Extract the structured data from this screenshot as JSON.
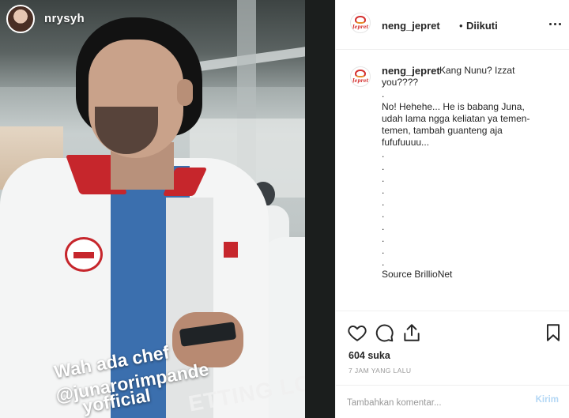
{
  "story": {
    "username": "nrysyh",
    "sticker_lines": [
      "Wah ada chef",
      "@junarorimpande",
      "yofficial"
    ],
    "bottom_caption": "ETTING LONG"
  },
  "post": {
    "header": {
      "username": "neng_jepret",
      "separator": "•",
      "follow_status": "Diikuti",
      "logo_text": "Jepret"
    },
    "caption": {
      "username": "neng_jepret",
      "lines": [
        "Kang Nunu? Izzat",
        "you????",
        ".",
        "No! Hehehe... He is babang Juna,",
        "udah lama ngga keliatan ya temen-",
        "temen, tambah guanteng aja",
        "fufufuuuu...",
        ".",
        ".",
        ".",
        ".",
        ".",
        ".",
        ".",
        ".",
        ".",
        ".",
        "Source BrillioNet"
      ]
    },
    "likes": "604 suka",
    "time": "7 JAM YANG LALU",
    "comment": {
      "placeholder": "Tambahkan komentar...",
      "post_label": "Kirim"
    },
    "icons": [
      "heart-icon",
      "comment-icon",
      "share-icon",
      "bookmark-icon",
      "more-options-icon"
    ]
  },
  "colors": {
    "text": "#262626",
    "muted": "#999999",
    "border": "#efefef",
    "post_button": "#b3d7f5",
    "collar_red": "#c6262c",
    "shirt_blue": "#3b6fae"
  }
}
